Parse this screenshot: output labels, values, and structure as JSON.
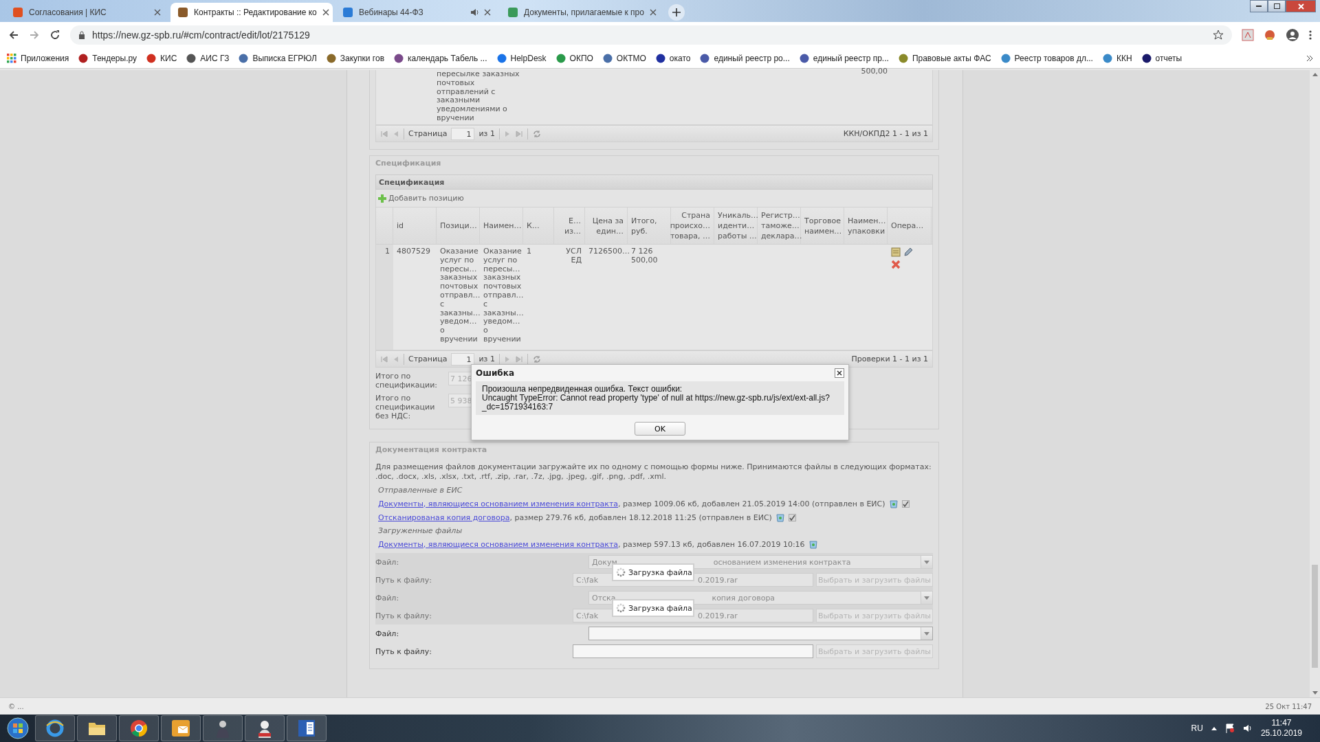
{
  "browser": {
    "tabs": [
      {
        "title": "Согласования | КИС",
        "selected": false,
        "audio": false
      },
      {
        "title": "Контракты :: Редактирование ко",
        "selected": true,
        "audio": false
      },
      {
        "title": "Вебинары 44-ФЗ",
        "selected": false,
        "audio": true
      },
      {
        "title": "Документы, прилагаемые к про",
        "selected": false,
        "audio": false
      }
    ],
    "url": "https://new.gz-spb.ru/#cm/contract/edit/lot/2175129",
    "bookmarks": [
      "Приложения",
      "Тендеры.ру",
      "КИС",
      "АИС ГЗ",
      "Выписка ЕГРЮЛ",
      "Закупки гов",
      "календарь Табель ...",
      "HelpDesk",
      "ОКПО",
      "ОКТМО",
      "окато",
      "единый реестр ро...",
      "единый реестр пр...",
      "Правовые акты ФАС",
      "Реестр товаров дл...",
      "ККН",
      "отчеты"
    ]
  },
  "top_grid": {
    "cell": "пересылке заказных\nпочтовых\nотправлений с\nзаказными\nуведомлениями о\nвручении",
    "amount": "500,00",
    "pager": {
      "page_label": "Страница",
      "page": "1",
      "total": "из 1",
      "summary": "ККН/ОКПД2 1 - 1 из 1"
    }
  },
  "specification": {
    "legend": "Спецификация",
    "panel_title": "Спецификация",
    "add_button": "Добавить позицию",
    "columns": [
      "id",
      "Позици…",
      "Наимен…",
      "К…",
      "Е…\nиз…",
      "Цена за\nедин…",
      "Итого,\nруб.",
      "Страна\nпроисхо…\nтовара, …",
      "Уникаль…\nиденти…\nработы …",
      "Регистр…\nтаможе…\nдеклара…",
      "Торговое\nнаимен…",
      "Наимен…\nупаковки",
      "Опера…"
    ],
    "rows": [
      {
        "number": "1",
        "cells": [
          "4807529",
          "Оказание\nуслуг по\nпересы…\nзаказных\nпочтовых\nотправл…\nс\nзаказны…\nуведом…\nо\nвручении",
          "Оказание\nуслуг по\nпересы…\nзаказных\nпочтовых\nотправл…\nс\nзаказны…\nуведом…\nо\nвручении",
          "1",
          "УСЛ\nЕД",
          "7126500…",
          "7 126\n500,00"
        ]
      }
    ],
    "pager": {
      "page_label": "Страница",
      "page": "1",
      "total": "из 1",
      "summary": "Проверки 1 - 1 из 1"
    },
    "totals": [
      {
        "label": "Итого по\nспецификации:",
        "value": "7 126"
      },
      {
        "label": "Итого по\nспецификации\nбез НДС:",
        "value": "5 938"
      }
    ]
  },
  "documents": {
    "legend": "Документация контракта",
    "intro": "Для размещения файлов документации загружайте их по одному с помощью формы ниже. Принимаются файлы в следующих форматах: .doc, .docx, .xls, .xlsx, .txt, .rtf, .zip, .rar, .7z, .jpg, .jpeg, .gif, .png, .pdf, .xml.",
    "groups": [
      {
        "title": "Отправленные в ЕИС",
        "files": [
          {
            "link": "Документы, являющиеся основанием изменения контракта",
            "details": ", размер 1009.06 кб, добавлен 21.05.2019 14:00 (отправлен в ЕИС)",
            "checked": true
          },
          {
            "link": "Отсканированая копия договора",
            "details": ", размер 279.76 кб, добавлен 18.12.2018 11:25 (отправлен в ЕИС)",
            "checked": true
          }
        ]
      },
      {
        "title": "Загруженные файлы",
        "files": [
          {
            "link": "Документы, являющиеся основанием изменения контракта",
            "details": ", размер 597.13 кб, добавлен 16.07.2019 10:16"
          }
        ]
      }
    ],
    "form": [
      {
        "kind": "combo",
        "label": "Файл:",
        "disabled": true,
        "value_start": "Докум",
        "value_end": "основанием изменения контракта",
        "loading": "Загрузка файла"
      },
      {
        "kind": "path",
        "label": "Путь к файлу:",
        "disabled": true,
        "value_start": "C:\\fak",
        "value_end": "0.2019.rar",
        "button": "Выбрать и загрузить файлы"
      },
      {
        "kind": "combo",
        "label": "Файл:",
        "disabled": true,
        "value_start": "Отска",
        "value_end": "копия договора",
        "loading": "Загрузка файла"
      },
      {
        "kind": "path",
        "label": "Путь к файлу:",
        "disabled": true,
        "value_start": "C:\\fak",
        "value_end": "0.2019.rar",
        "button": "Выбрать и загрузить файлы"
      },
      {
        "kind": "combo",
        "label": "Файл:",
        "disabled": false
      },
      {
        "kind": "path",
        "label": "Путь к файлу:",
        "disabled": false,
        "button": "Выбрать и загрузить файлы"
      }
    ]
  },
  "dialog": {
    "title": "Ошибка",
    "message": "Произошла непредвиденная ошибка. Текст ошибки:\nUncaught TypeError: Cannot read property 'type' of null at https://new.gz-spb.ru/js/ext/ext-all.js?_dc=1571934163:7",
    "button": "OK"
  },
  "status_bar": {
    "left": "© ...",
    "right": "25 Окт 11:47"
  },
  "taskbar": {
    "language": "RU",
    "time": "11:47",
    "date": "25.10.2019"
  }
}
